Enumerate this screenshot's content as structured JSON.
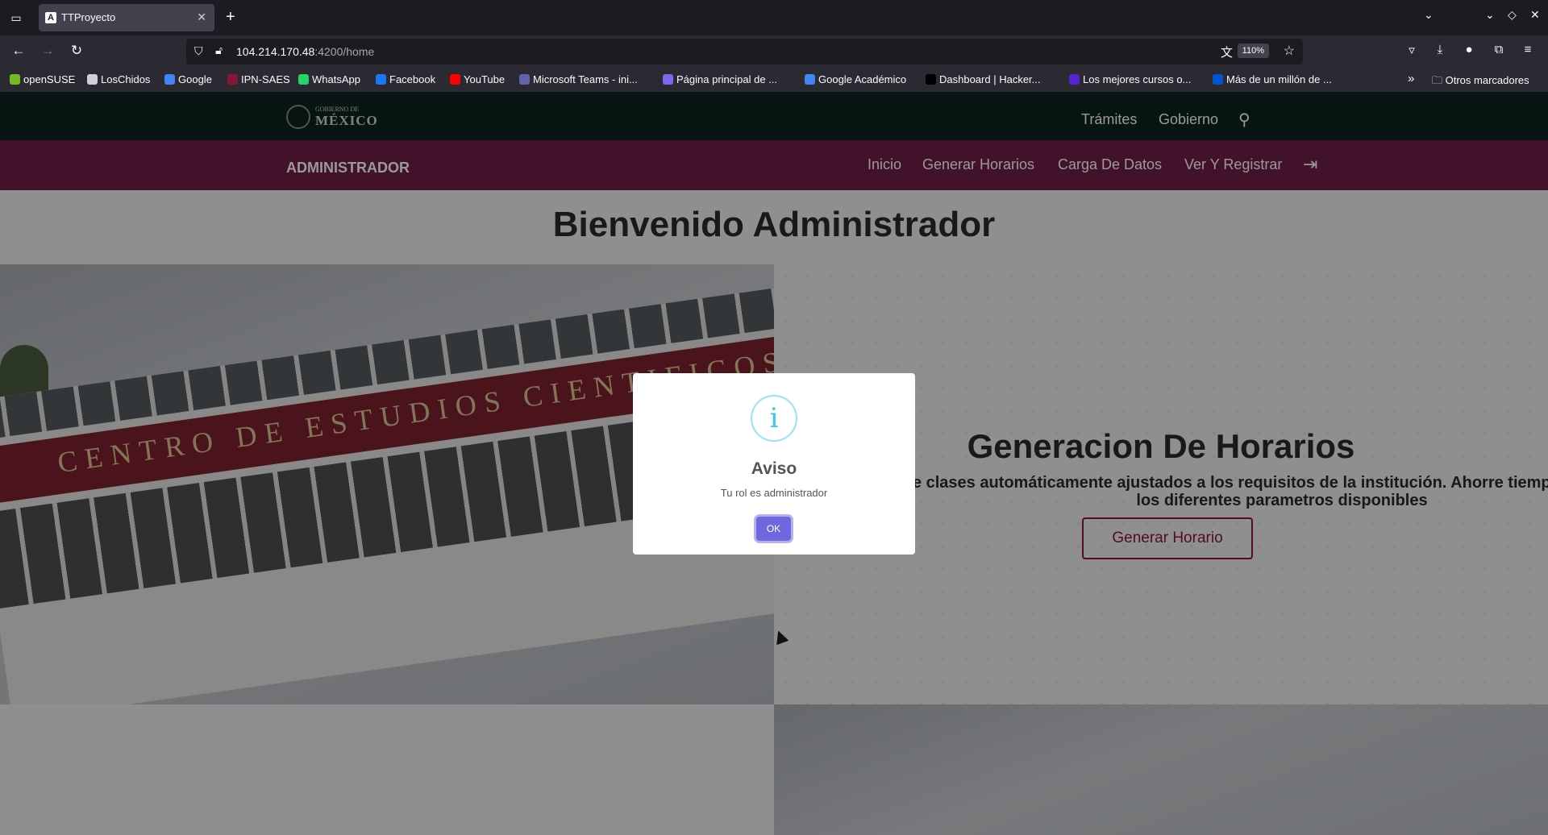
{
  "browser": {
    "tab_title": "TTProyecto",
    "tab_favicon": "A",
    "url_host": "104.214.170.48",
    "url_path": ":4200/home",
    "zoom": "110%",
    "bookmarks": [
      {
        "label": "openSUSE",
        "color": "#73ba25"
      },
      {
        "label": "LosChidos",
        "color": "#cfcfd8"
      },
      {
        "label": "Google",
        "color": "#4285f4"
      },
      {
        "label": "IPN-SAES",
        "color": "#8a1538"
      },
      {
        "label": "WhatsApp",
        "color": "#25d366"
      },
      {
        "label": "Facebook",
        "color": "#1877f2"
      },
      {
        "label": "YouTube",
        "color": "#ff0000"
      },
      {
        "label": "Microsoft Teams - ini...",
        "color": "#6264a7"
      },
      {
        "label": "Página principal de ...",
        "color": "#7b68ee"
      },
      {
        "label": "Google Académico",
        "color": "#4285f4"
      },
      {
        "label": "Dashboard | Hacker...",
        "color": "#000000"
      },
      {
        "label": "Los mejores cursos o...",
        "color": "#5624d0"
      },
      {
        "label": "Más de un millón de ...",
        "color": "#0056d2"
      }
    ],
    "other_bookmarks": "Otros marcadores"
  },
  "gov_header": {
    "logo_line1": "GOBIERNO DE",
    "logo_line2": "MÉXICO",
    "links": [
      "Trámites",
      "Gobierno"
    ]
  },
  "admin_nav": {
    "brand": "ADMINISTRADOR",
    "links": [
      "Inicio",
      "Generar Horarios",
      "Carga De Datos",
      "Ver Y Registrar"
    ]
  },
  "main": {
    "welcome": "Bienvenido Administrador",
    "photo_sign": "CENTRO DE ESTUDIOS CIENTIFICOS Y TECNOLOGICOS",
    "section_title": "Generacion De Horarios",
    "section_desc": "le clases automáticamente ajustados a los requisitos de la institución. Ahorre tiempo y modifique los diferentes parametros disponibles",
    "section_button": "Generar Horario"
  },
  "modal": {
    "icon": "i",
    "title": "Aviso",
    "text": "Tu rol es administrador",
    "ok": "OK"
  }
}
